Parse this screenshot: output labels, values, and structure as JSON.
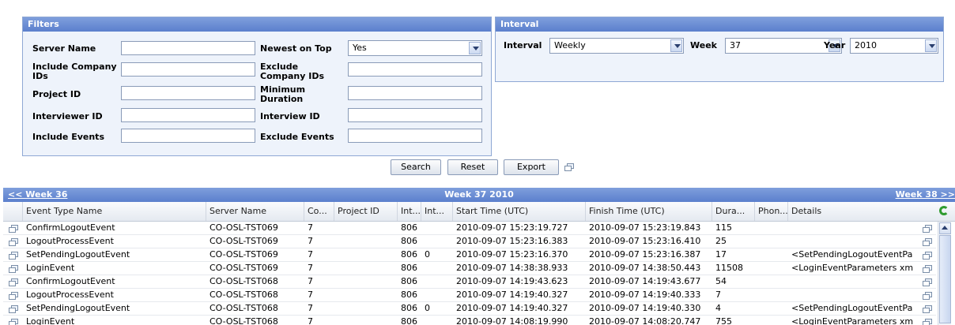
{
  "filters": {
    "title": "Filters",
    "server_name_label": "Server Name",
    "include_company_label": "Include Company IDs",
    "project_id_label": "Project ID",
    "interviewer_id_label": "Interviewer ID",
    "include_events_label": "Include Events",
    "newest_on_top_label": "Newest on Top",
    "newest_on_top_value": "Yes",
    "exclude_company_label": "Exclude Company IDs",
    "minimum_duration_label": "Minimum Duration",
    "interview_id_label": "Interview ID",
    "exclude_events_label": "Exclude Events",
    "server_name_value": "",
    "include_company_value": "",
    "project_id_value": "",
    "interviewer_id_value": "",
    "include_events_value": "",
    "exclude_company_value": "",
    "minimum_duration_value": "",
    "interview_id_value": "",
    "exclude_events_value": ""
  },
  "interval": {
    "title": "Interval",
    "interval_label": "Interval",
    "interval_value": "Weekly",
    "week_label": "Week",
    "week_value": "37",
    "year_label": "Year",
    "year_value": "2010"
  },
  "actions": {
    "search": "Search",
    "reset": "Reset",
    "export": "Export"
  },
  "week_nav": {
    "prev": "<< Week 36",
    "current": "Week 37 2010",
    "next": "Week 38 >>"
  },
  "grid": {
    "columns": [
      "Event Type Name",
      "Server Name",
      "Co...",
      "Project ID",
      "Int...",
      "Int...",
      "Start Time (UTC)",
      "Finish Time (UTC)",
      "Dura...",
      "Phon...",
      "Details"
    ],
    "rows": [
      {
        "event": "ConfirmLogoutEvent",
        "server": "CO-OSL-TST069",
        "co": "7",
        "project": "",
        "int1": "806",
        "int2": "",
        "start": "2010-09-07 15:23:19.727",
        "finish": "2010-09-07 15:23:19.843",
        "duration": "115",
        "phone": "",
        "details": ""
      },
      {
        "event": "LogoutProcessEvent",
        "server": "CO-OSL-TST069",
        "co": "7",
        "project": "",
        "int1": "806",
        "int2": "",
        "start": "2010-09-07 15:23:16.383",
        "finish": "2010-09-07 15:23:16.410",
        "duration": "25",
        "phone": "",
        "details": ""
      },
      {
        "event": "SetPendingLogoutEvent",
        "server": "CO-OSL-TST069",
        "co": "7",
        "project": "",
        "int1": "806",
        "int2": "0",
        "start": "2010-09-07 15:23:16.370",
        "finish": "2010-09-07 15:23:16.387",
        "duration": "17",
        "phone": "",
        "details": "<SetPendingLogoutEventPa"
      },
      {
        "event": "LoginEvent",
        "server": "CO-OSL-TST069",
        "co": "7",
        "project": "",
        "int1": "806",
        "int2": "",
        "start": "2010-09-07 14:38:38.933",
        "finish": "2010-09-07 14:38:50.443",
        "duration": "11508",
        "phone": "",
        "details": "<LoginEventParameters xm"
      },
      {
        "event": "ConfirmLogoutEvent",
        "server": "CO-OSL-TST068",
        "co": "7",
        "project": "",
        "int1": "806",
        "int2": "",
        "start": "2010-09-07 14:19:43.623",
        "finish": "2010-09-07 14:19:43.677",
        "duration": "54",
        "phone": "",
        "details": ""
      },
      {
        "event": "LogoutProcessEvent",
        "server": "CO-OSL-TST068",
        "co": "7",
        "project": "",
        "int1": "806",
        "int2": "",
        "start": "2010-09-07 14:19:40.327",
        "finish": "2010-09-07 14:19:40.333",
        "duration": "7",
        "phone": "",
        "details": ""
      },
      {
        "event": "SetPendingLogoutEvent",
        "server": "CO-OSL-TST068",
        "co": "7",
        "project": "",
        "int1": "806",
        "int2": "0",
        "start": "2010-09-07 14:19:40.327",
        "finish": "2010-09-07 14:19:40.330",
        "duration": "4",
        "phone": "",
        "details": "<SetPendingLogoutEventPa"
      },
      {
        "event": "LoginEvent",
        "server": "CO-OSL-TST068",
        "co": "7",
        "project": "",
        "int1": "806",
        "int2": "",
        "start": "2010-09-07 14:08:19.990",
        "finish": "2010-09-07 14:08:20.747",
        "duration": "755",
        "phone": "",
        "details": "<LoginEventParameters xm"
      }
    ]
  }
}
